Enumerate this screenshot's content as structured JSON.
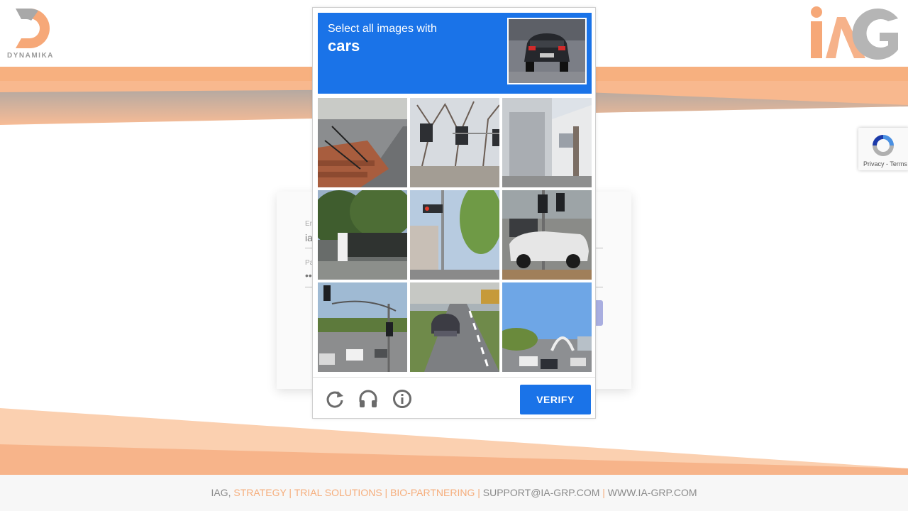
{
  "brand": {
    "left_logo_text": "DYNAMIKA",
    "left_logo_letter": "D",
    "right_logo_text": "iAG",
    "orange": "#f6ad7b",
    "gray": "#b5b5b5"
  },
  "login": {
    "email_label": "Em",
    "email_value": "ia",
    "password_label": "Pa",
    "password_value": "••"
  },
  "captcha": {
    "prompt": "Select all images with",
    "target": "cars",
    "accent": "#1a73e8",
    "tiles": [
      {
        "name": "tile-stairs-road"
      },
      {
        "name": "tile-traffic-lights-trees"
      },
      {
        "name": "tile-building-street"
      },
      {
        "name": "tile-park-trees"
      },
      {
        "name": "tile-traffic-light-city"
      },
      {
        "name": "tile-parked-cars"
      },
      {
        "name": "tile-highway-traffic"
      },
      {
        "name": "tile-road-car"
      },
      {
        "name": "tile-bridge-cars"
      }
    ],
    "icons": [
      "reload-icon",
      "headphones-icon",
      "info-icon"
    ],
    "verify_label": "VERIFY"
  },
  "recaptcha_badge": {
    "text": "Privacy - Terms"
  },
  "footer": {
    "company": "IAG, ",
    "services": "STRATEGY | TRIAL SOLUTIONS | BIO-PARTNERING | ",
    "email": "SUPPORT@IA-GRP.COM",
    "separator": " | ",
    "website": "WWW.IA-GRP.COM"
  }
}
